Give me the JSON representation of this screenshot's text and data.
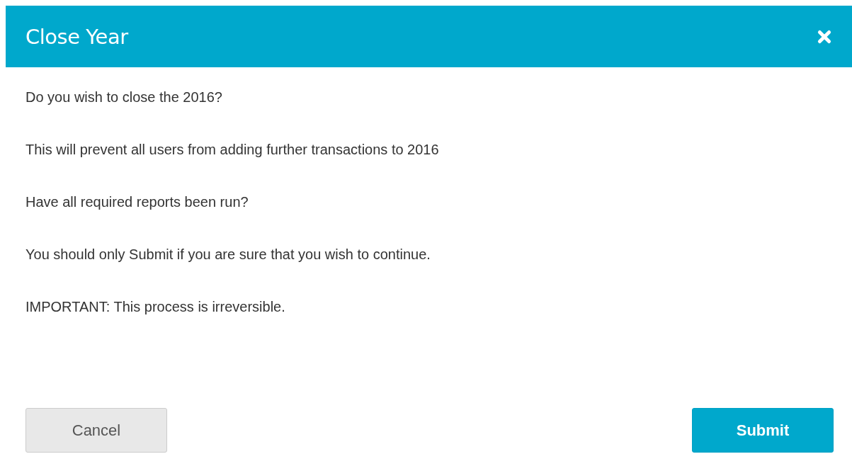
{
  "dialog": {
    "title": "Close Year",
    "paragraphs": [
      "Do you wish to close the 2016?",
      "This will prevent all users from adding further transactions to 2016",
      "Have all required reports been run?",
      "You should only Submit if you are sure that you wish to continue.",
      "IMPORTANT: This process is irreversible."
    ],
    "buttons": [
      {
        "label": "Cancel",
        "kind": "secondary"
      },
      {
        "label": "Submit",
        "kind": "primary"
      }
    ]
  }
}
